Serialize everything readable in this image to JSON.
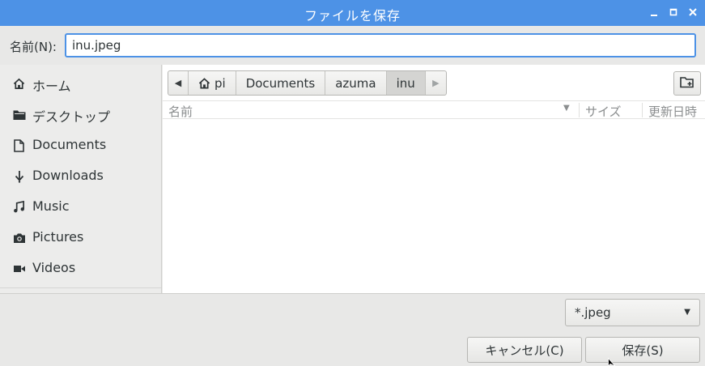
{
  "window": {
    "title": "ファイルを保存"
  },
  "name_row": {
    "label": "名前(N):",
    "value": "inu.jpeg"
  },
  "sidebar": {
    "items": [
      {
        "label": "ホーム",
        "icon": "home-icon"
      },
      {
        "label": "デスクトップ",
        "icon": "folder-icon"
      },
      {
        "label": "Documents",
        "icon": "document-icon"
      },
      {
        "label": "Downloads",
        "icon": "download-icon"
      },
      {
        "label": "Music",
        "icon": "music-icon"
      },
      {
        "label": "Pictures",
        "icon": "camera-icon"
      },
      {
        "label": "Videos",
        "icon": "video-icon"
      }
    ]
  },
  "pathbar": {
    "crumbs": [
      {
        "label": "pi",
        "icon": "home-icon"
      },
      {
        "label": "Documents"
      },
      {
        "label": "azuma"
      },
      {
        "label": "inu",
        "active": true
      }
    ]
  },
  "columns": {
    "name": "名前",
    "size": "サイズ",
    "modified": "更新日時"
  },
  "filter": {
    "selected": "*.jpeg"
  },
  "buttons": {
    "cancel": "キャンセル(C)",
    "save": "保存(S)"
  },
  "colors": {
    "titlebar": "#4d92e6",
    "focus_border": "#4d92e6"
  }
}
